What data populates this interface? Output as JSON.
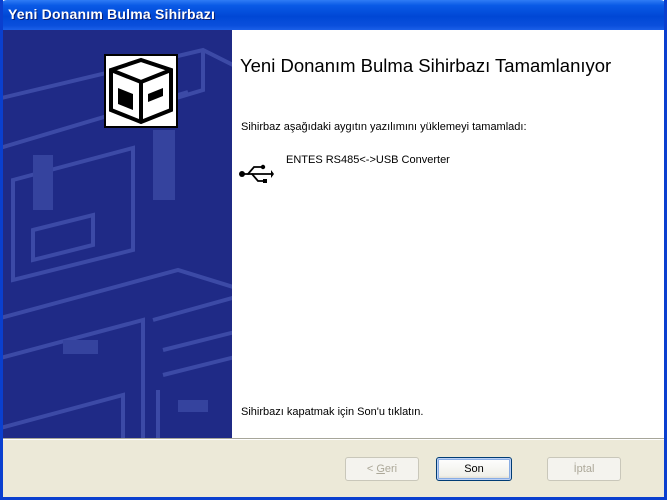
{
  "window": {
    "title": "Yeni Donanım Bulma Sihirbazı"
  },
  "main": {
    "heading": "Yeni Donanım Bulma Sihirbazı Tamamlanıyor",
    "subtext": "Sihirbaz aşağıdaki aygıtın yazılımını yüklemeyi tamamladı:",
    "device": {
      "icon": "usb-icon",
      "name": "ENTES RS485<->USB Converter"
    },
    "close_hint": "Sihirbazı kapatmak için Son'u tıklatın."
  },
  "buttons": {
    "back_prefix": "< ",
    "back_accel": "G",
    "back_rest": "eri",
    "finish": "Son",
    "cancel": "İptal"
  },
  "colors": {
    "titlebar": "#0a50dc",
    "side_panel": "#1f2a86",
    "dialog_footer": "#ece9d8"
  }
}
